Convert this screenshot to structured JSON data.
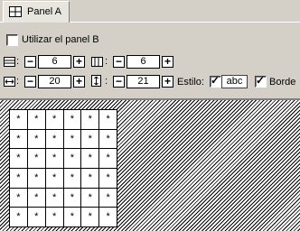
{
  "tab": {
    "label": "Panel A",
    "icon": "grid-icon"
  },
  "use_panel_b": {
    "label": "Utilizar el panel B",
    "checked": false
  },
  "rows": {
    "icon": "rows-icon",
    "value": "6"
  },
  "cols": {
    "icon": "columns-icon",
    "value": "6"
  },
  "cell_width": {
    "icon": "width-icon",
    "value": "20"
  },
  "cell_height": {
    "icon": "height-icon",
    "value": "21"
  },
  "separator": ":",
  "minus": "−",
  "plus": "+",
  "style": {
    "label": "Estilo:",
    "checked": true,
    "sample": "abc"
  },
  "border": {
    "label": "Borde",
    "checked": true
  },
  "check_mark": "✓",
  "preview": {
    "cell_text": "*",
    "rows": 6,
    "cols": 6
  }
}
